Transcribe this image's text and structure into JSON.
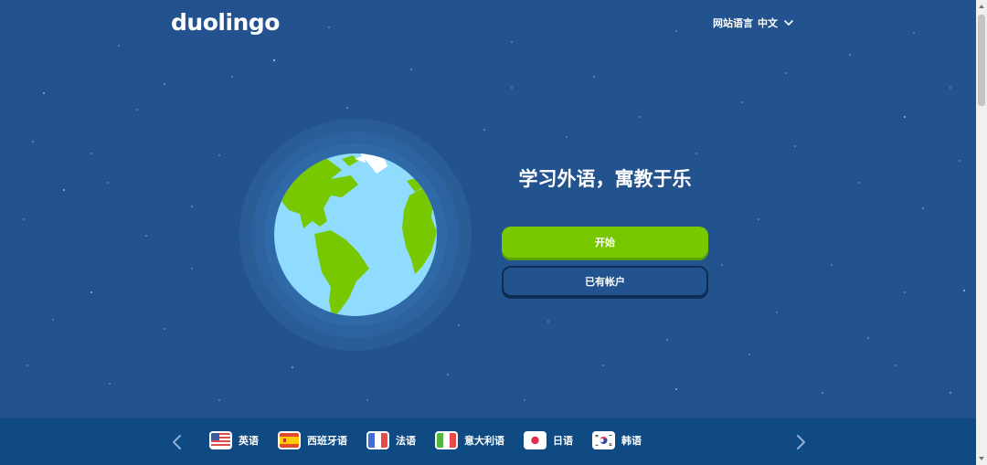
{
  "header": {
    "logo": "duolingo",
    "site_language_label": "网站语言",
    "site_language_value": "中文"
  },
  "hero": {
    "tagline": "学习外语，寓教于乐",
    "start_button": "开始",
    "login_button": "已有帐户"
  },
  "footer": {
    "languages": [
      {
        "label": "英语",
        "flag": "us-flag-icon"
      },
      {
        "label": "西班牙语",
        "flag": "spain-flag-icon"
      },
      {
        "label": "法语",
        "flag": "france-flag-icon"
      },
      {
        "label": "意大利语",
        "flag": "italy-flag-icon"
      },
      {
        "label": "日语",
        "flag": "japan-flag-icon"
      },
      {
        "label": "韩语",
        "flag": "korea-flag-icon"
      }
    ]
  },
  "colors": {
    "background": "#23538f",
    "footer": "#0f4a82",
    "primary_green": "#78c800",
    "ocean": "#8fdcff",
    "land": "#78c800"
  }
}
